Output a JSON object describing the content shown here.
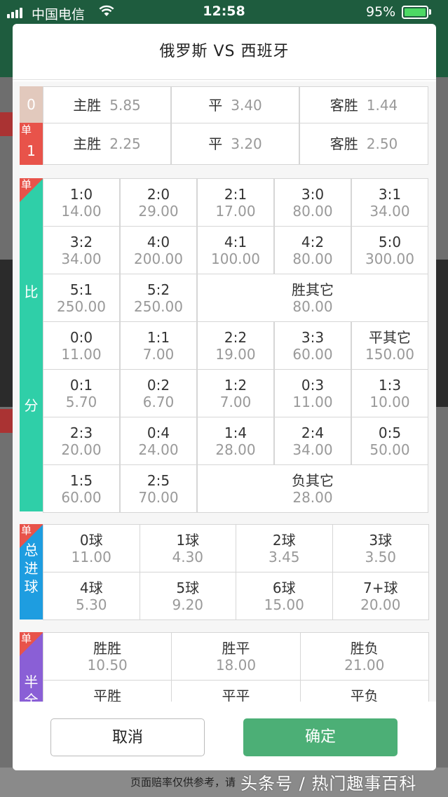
{
  "status_bar": {
    "carrier": "中国电信",
    "time": "12:58",
    "battery": "95%"
  },
  "modal": {
    "title": "俄罗斯  VS  西班牙",
    "cancel_label": "取消",
    "ok_label": "确定"
  },
  "spf": {
    "row0": {
      "label": "0",
      "items": [
        {
          "label": "主胜",
          "odds": "5.85"
        },
        {
          "label": "平",
          "odds": "3.40"
        },
        {
          "label": "客胜",
          "odds": "1.44"
        }
      ]
    },
    "row1": {
      "label": "1",
      "single": "单",
      "items": [
        {
          "label": "主胜",
          "odds": "2.25"
        },
        {
          "label": "平",
          "odds": "3.20"
        },
        {
          "label": "客胜",
          "odds": "2.50"
        }
      ]
    }
  },
  "score": {
    "single": "单",
    "title_top": "比",
    "title_bottom": "分",
    "items": [
      {
        "label": "1:0",
        "odds": "14.00"
      },
      {
        "label": "2:0",
        "odds": "29.00"
      },
      {
        "label": "2:1",
        "odds": "17.00"
      },
      {
        "label": "3:0",
        "odds": "80.00"
      },
      {
        "label": "3:1",
        "odds": "34.00"
      },
      {
        "label": "3:2",
        "odds": "34.00"
      },
      {
        "label": "4:0",
        "odds": "200.00"
      },
      {
        "label": "4:1",
        "odds": "100.00"
      },
      {
        "label": "4:2",
        "odds": "80.00"
      },
      {
        "label": "5:0",
        "odds": "300.00"
      },
      {
        "label": "5:1",
        "odds": "250.00"
      },
      {
        "label": "5:2",
        "odds": "250.00"
      },
      {
        "label": "胜其它",
        "odds": "80.00"
      },
      {
        "label": "0:0",
        "odds": "11.00"
      },
      {
        "label": "1:1",
        "odds": "7.00"
      },
      {
        "label": "2:2",
        "odds": "19.00"
      },
      {
        "label": "3:3",
        "odds": "60.00"
      },
      {
        "label": "平其它",
        "odds": "150.00"
      },
      {
        "label": "0:1",
        "odds": "5.70"
      },
      {
        "label": "0:2",
        "odds": "6.70"
      },
      {
        "label": "1:2",
        "odds": "7.00"
      },
      {
        "label": "0:3",
        "odds": "11.00"
      },
      {
        "label": "1:3",
        "odds": "10.00"
      },
      {
        "label": "2:3",
        "odds": "20.00"
      },
      {
        "label": "0:4",
        "odds": "24.00"
      },
      {
        "label": "1:4",
        "odds": "28.00"
      },
      {
        "label": "2:4",
        "odds": "34.00"
      },
      {
        "label": "0:5",
        "odds": "50.00"
      },
      {
        "label": "1:5",
        "odds": "60.00"
      },
      {
        "label": "2:5",
        "odds": "70.00"
      },
      {
        "label": "负其它",
        "odds": "28.00"
      }
    ]
  },
  "goals": {
    "single": "单",
    "title": [
      "总",
      "进",
      "球"
    ],
    "items": [
      {
        "label": "0球",
        "odds": "11.00"
      },
      {
        "label": "1球",
        "odds": "4.30"
      },
      {
        "label": "2球",
        "odds": "3.45"
      },
      {
        "label": "3球",
        "odds": "3.50"
      },
      {
        "label": "4球",
        "odds": "5.30"
      },
      {
        "label": "5球",
        "odds": "9.20"
      },
      {
        "label": "6球",
        "odds": "15.00"
      },
      {
        "label": "7+球",
        "odds": "20.00"
      }
    ]
  },
  "halffull": {
    "single": "单",
    "title": [
      "半",
      "全"
    ],
    "items": [
      {
        "label": "胜胜",
        "odds": "10.50"
      },
      {
        "label": "胜平",
        "odds": "18.00"
      },
      {
        "label": "胜负",
        "odds": "21.00"
      },
      {
        "label": "平胜",
        "odds": ""
      },
      {
        "label": "平平",
        "odds": ""
      },
      {
        "label": "平负",
        "odds": ""
      }
    ]
  },
  "background": {
    "footer_text": "页面赔率仅供参考，请"
  },
  "watermark": "头条号 / 热门趣事百科",
  "colors": {
    "spf0": "#e2c9bd",
    "spf1": "#e8534a",
    "score": "#2fcfa8",
    "goals": "#1e9de0",
    "halffull": "#8a5fd6",
    "ok": "#4caf76"
  }
}
